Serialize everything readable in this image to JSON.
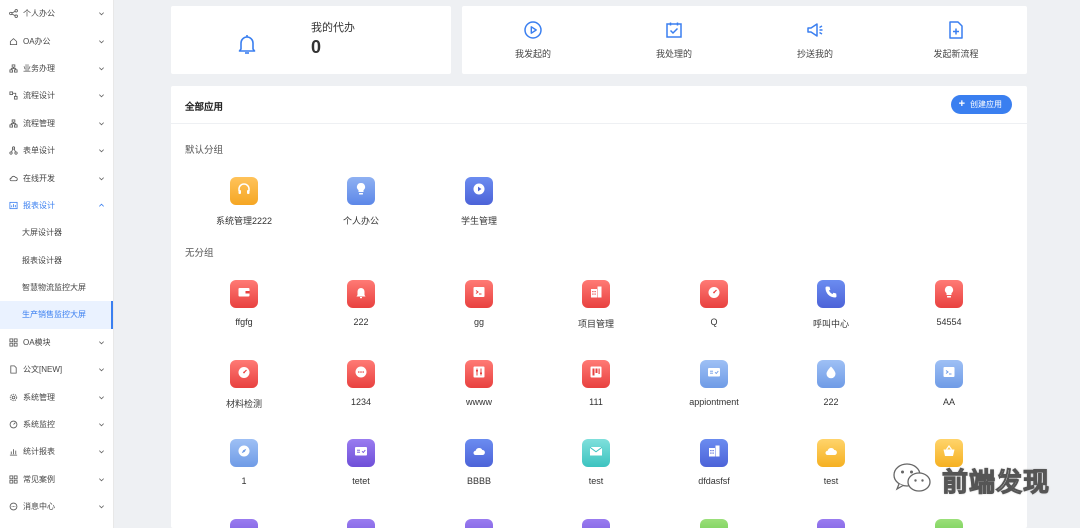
{
  "sidebar": {
    "items": [
      {
        "label": "个人办公",
        "icon": "share-icon",
        "expanded": false
      },
      {
        "label": "OA办公",
        "icon": "home-icon",
        "expanded": false
      },
      {
        "label": "业务办理",
        "icon": "org-icon",
        "expanded": false
      },
      {
        "label": "流程设计",
        "icon": "flow-icon",
        "expanded": false
      },
      {
        "label": "流程管理",
        "icon": "org-icon",
        "expanded": false
      },
      {
        "label": "表单设计",
        "icon": "form-tree-icon",
        "expanded": false
      },
      {
        "label": "在线开发",
        "icon": "cloud-icon",
        "expanded": false
      },
      {
        "label": "报表设计",
        "icon": "chart-icon",
        "expanded": true
      }
    ],
    "report_sub_items": [
      {
        "label": "大屏设计器",
        "active": false
      },
      {
        "label": "报表设计器",
        "active": false
      },
      {
        "label": "智慧物流监控大屏",
        "active": false
      },
      {
        "label": "生产销售监控大屏",
        "active": true
      }
    ],
    "items_after": [
      {
        "label": "OA模块",
        "icon": "grid-icon"
      },
      {
        "label": "公文[NEW]",
        "icon": "doc-icon"
      },
      {
        "label": "系统管理",
        "icon": "gear-icon"
      },
      {
        "label": "系统监控",
        "icon": "monitor-icon"
      },
      {
        "label": "统计报表",
        "icon": "bar-chart-icon"
      },
      {
        "label": "常见案例",
        "icon": "grid-icon"
      },
      {
        "label": "消息中心",
        "icon": "message-icon"
      }
    ]
  },
  "todo": {
    "label": "我的代办",
    "count": "0"
  },
  "quick_actions": [
    {
      "label": "我发起的",
      "icon": "play-circle-icon"
    },
    {
      "label": "我处理的",
      "icon": "calendar-check-icon"
    },
    {
      "label": "抄送我的",
      "icon": "megaphone-icon"
    },
    {
      "label": "发起新流程",
      "icon": "file-add-icon"
    }
  ],
  "panel": {
    "title": "全部应用",
    "create_label": "创建应用"
  },
  "groups": {
    "default_title": "默认分组",
    "ungrouped_title": "无分组"
  },
  "default_apps": [
    {
      "label": "系统管理2222",
      "icon": "headset-icon",
      "color": "#f5a623"
    },
    {
      "label": "个人办公",
      "icon": "bulb-icon",
      "color": "#6f9be6"
    },
    {
      "label": "学生管理",
      "icon": "play-icon",
      "color": "#4c63d8"
    }
  ],
  "ungrouped_apps": [
    {
      "label": "ffgfg",
      "icon": "wallet-icon",
      "color": "#e8413f"
    },
    {
      "label": "222",
      "icon": "bell-icon",
      "color": "#e8413f"
    },
    {
      "label": "gg",
      "icon": "terminal-icon",
      "color": "#e8413f"
    },
    {
      "label": "项目管理",
      "icon": "building-icon",
      "color": "#e8413f"
    },
    {
      "label": "Q",
      "icon": "dashboard-icon",
      "color": "#e8413f"
    },
    {
      "label": "呼叫中心",
      "icon": "phone-icon",
      "color": "#4c63d8"
    },
    {
      "label": "54554",
      "icon": "bulb-icon",
      "color": "#e8413f"
    },
    {
      "label": "材料检测",
      "icon": "dashboard-icon",
      "color": "#e8413f"
    },
    {
      "label": "1234",
      "icon": "chat-icon",
      "color": "#e8413f"
    },
    {
      "label": "wwww",
      "icon": "sliders-icon",
      "color": "#e8413f"
    },
    {
      "label": "111",
      "icon": "board-icon",
      "color": "#e8413f"
    },
    {
      "label": "appiontment",
      "icon": "ticket-icon",
      "color": "#6f9be6"
    },
    {
      "label": "222",
      "icon": "drop-icon",
      "color": "#6f9be6"
    },
    {
      "label": "AA",
      "icon": "terminal-icon",
      "color": "#6f9be6"
    },
    {
      "label": "1",
      "icon": "compass-icon",
      "color": "#6f9be6"
    },
    {
      "label": "tetet",
      "icon": "ticket-icon",
      "color": "#6e4fd8"
    },
    {
      "label": "BBBB",
      "icon": "cloud-icon",
      "color": "#4c63d8"
    },
    {
      "label": "test",
      "icon": "mail-icon",
      "color": "#3cc3c0"
    },
    {
      "label": "dfdasfsf",
      "icon": "building-icon",
      "color": "#4c63d8"
    },
    {
      "label": "test",
      "icon": "cloud-icon",
      "color": "#f5b021"
    },
    {
      "label": "",
      "icon": "basket-icon",
      "color": "#f5b021"
    }
  ],
  "watermark": {
    "text": "前端发现",
    "icon": "wechat-icon"
  }
}
